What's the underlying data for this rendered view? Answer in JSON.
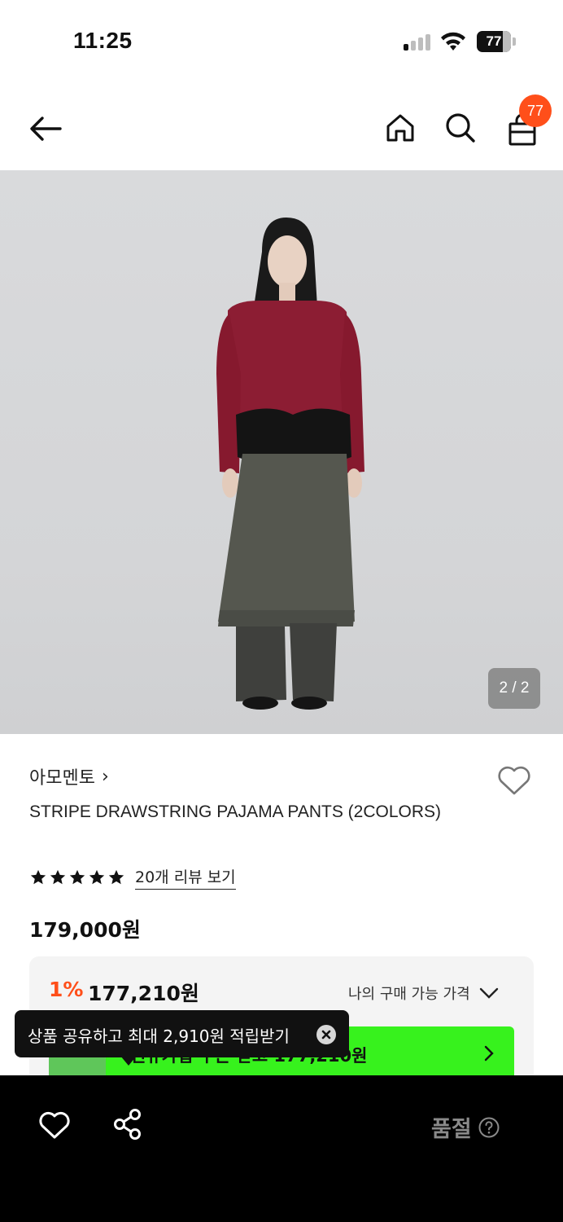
{
  "status_bar": {
    "time": "11:25",
    "battery": "77",
    "battery_level": 0.77
  },
  "nav": {
    "back_icon": "arrow-left-icon",
    "home_icon": "home-icon",
    "search_icon": "search-icon",
    "cart_icon": "shopping-bag-icon",
    "cart_count": "77"
  },
  "gallery": {
    "counter": "2 / 2"
  },
  "product": {
    "brand": "아모멘토",
    "brand_chevron": "›",
    "name": "STRIPE DRAWSTRING PAJAMA PANTS (2COLORS)",
    "rating_stars": 5,
    "review_link": "20개 리뷰 보기",
    "price": "179,000원",
    "discount_rate": "1%",
    "discount_price": "177,210원",
    "my_price_label": "나의 구매 가능 가격"
  },
  "promo": {
    "text": "신규가입 쿠폰 받고 177,210원"
  },
  "tooltip": {
    "text": "상품 공유하고 최대 2,910원 적립받기"
  },
  "bottom_bar": {
    "status": "품절"
  },
  "colors": {
    "accent": "#ff4f1a",
    "promo": "#37f21d",
    "price_box": "#f4f4f4",
    "bottom_bar": "#000000"
  }
}
